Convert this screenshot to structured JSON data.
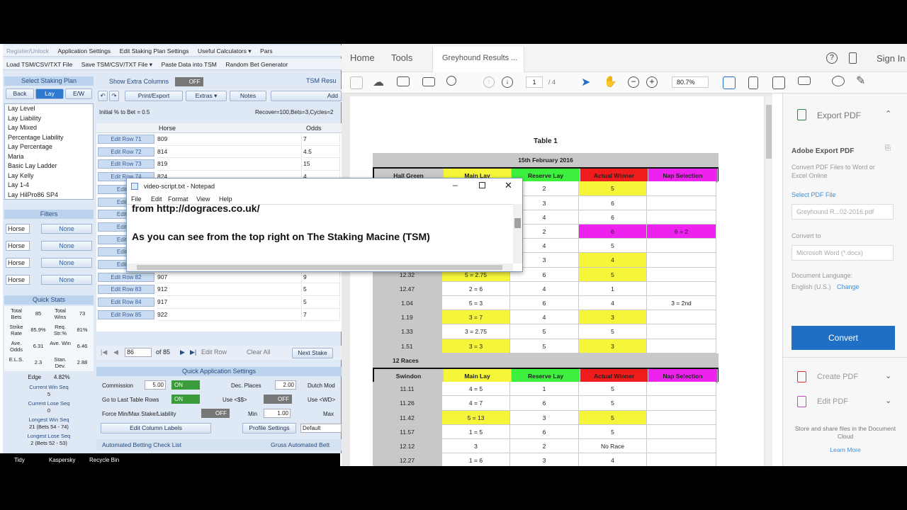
{
  "tsm": {
    "toolbar1": [
      "Register/Unlock",
      "Application Settings",
      "Edit Staking Plan Settings",
      "Useful Calculators ▾",
      "Pars"
    ],
    "toolbar2": [
      "Load TSM/CSV/TXT File",
      "Save TSM/CSV/TXT File ▾",
      "Paste Data into TSM",
      "Random Bet Generator"
    ],
    "select_plan_title": "Select Staking Plan",
    "plan_tabs": [
      "Back",
      "Lay",
      "E/W"
    ],
    "plans": [
      "Lay Level",
      "Lay Liability",
      "Lay Mixed",
      "Percentage Liability",
      "Lay Percentage",
      "Maria",
      "Basic Lay Ladder",
      "Lay Kelly",
      "Lay 1-4",
      "Lay HilPro86 SP4"
    ],
    "filters_title": "Filters",
    "filters": [
      {
        "field": "Horse",
        "value": "None"
      },
      {
        "field": "Horse",
        "value": "None"
      },
      {
        "field": "Horse",
        "value": "None"
      },
      {
        "field": "Horse",
        "value": "None"
      }
    ],
    "quick_stats_title": "Quick Stats",
    "stats": [
      {
        "l1": "Total Bets",
        "v1": "85",
        "l2": "Total Wins",
        "v2": "73"
      },
      {
        "l1": "Strike Rate",
        "v1": "85.9%",
        "l2": "Req. Str.%",
        "v2": "81%"
      },
      {
        "l1": "Ave. Odds",
        "v1": "6.31",
        "l2": "Ave. Win",
        "v2": "6.46"
      },
      {
        "l1": "E.L.S.",
        "v1": "2.3",
        "l2": "Stan. Dev.",
        "v2": "2.88"
      }
    ],
    "edge_label": "Edge",
    "edge_value": "4.82%",
    "seq": [
      {
        "label": "Current Win Seq",
        "value": "5"
      },
      {
        "label": "Current Lose Seq",
        "value": "0"
      },
      {
        "label": "Longest Win Seq",
        "value": "21  (Bets 54 - 74)"
      },
      {
        "label": "Longest Lose Seq",
        "value": "2  (Bets 52 - 53)"
      }
    ],
    "show_extra_columns": "Show Extra Columns",
    "off": "OFF",
    "on": "ON",
    "tsm_results": "TSM Resu",
    "actions": [
      "Print/Export",
      "Extras ▾",
      "Notes",
      "Add"
    ],
    "initial_pct": "Initial % to Bet = 0.5",
    "recover": "Recover=100,Bets=3,Cycles=2",
    "col_horse": "Horse",
    "col_odds": "Odds",
    "rows": [
      {
        "btn": "Edit Row 71",
        "horse": "809",
        "odds": "7"
      },
      {
        "btn": "Edit Row 72",
        "horse": "814",
        "odds": "4.5"
      },
      {
        "btn": "Edit Row 73",
        "horse": "819",
        "odds": "15"
      },
      {
        "btn": "Edit Row 74",
        "horse": "824",
        "odds": "4"
      },
      {
        "btn": "Edit Ro",
        "horse": "",
        "odds": ""
      },
      {
        "btn": "Edit Ro",
        "horse": "",
        "odds": ""
      },
      {
        "btn": "Edit Ro",
        "horse": "",
        "odds": ""
      },
      {
        "btn": "Edit Ro",
        "horse": "",
        "odds": ""
      },
      {
        "btn": "Edit Ro",
        "horse": "",
        "odds": ""
      },
      {
        "btn": "Edit Ro",
        "horse": "",
        "odds": ""
      },
      {
        "btn": "Edit Ro",
        "horse": "",
        "odds": ""
      },
      {
        "btn": "Edit Row 82",
        "horse": "907",
        "odds": "9"
      },
      {
        "btn": "Edit Row 83",
        "horse": "912",
        "odds": "5"
      },
      {
        "btn": "Edit Row 84",
        "horse": "917",
        "odds": "5"
      },
      {
        "btn": "Edit Row 85",
        "horse": "922",
        "odds": "7"
      }
    ],
    "pager_value": "86",
    "pager_of": "of 85",
    "edit_row": "Edit Row",
    "clear_all": "Clear All",
    "next_stake": "Next Stake",
    "quick_settings_title": "Quick Application Settings",
    "commission": "Commission",
    "commission_val": "5.00",
    "dec_places": "Dec. Places",
    "dec_val": "2.00",
    "dutch_mode": "Dutch Mod",
    "goto_last": "Go to Last Table Rows",
    "use_ss": "Use <$$>",
    "use_wd": "Use <WD>",
    "force_minmax": "Force Min/Max Stake/Liability",
    "min": "Min",
    "min_val": "1.00",
    "max": "Max",
    "edit_col_labels": "Edit Column Labels",
    "profile_settings": "Profile Settings",
    "default": "Default",
    "auto_betting": "Automated Betting Check List",
    "gruss": "Gruss Automated Bett"
  },
  "taskbar": [
    "Tidy",
    "Kaspersky",
    "Recycle Bin"
  ],
  "acrobat": {
    "menu": [
      "Home",
      "Tools",
      "Greyhound Results ..."
    ],
    "sign_in": "Sign In",
    "page_current": "1",
    "page_total": "/ 4",
    "zoom": "80.7%",
    "export_pdf": "Export PDF",
    "adobe_export_title": "Adobe Export PDF",
    "adobe_export_desc": "Convert PDF Files to Word or Excel Online",
    "select_pdf_file": "Select PDF File",
    "file_name": "Greyhound R...02-2016.pdf",
    "convert_to": "Convert to",
    "convert_format": "Microsoft Word (*.docx)",
    "doc_language": "Document Language:",
    "language": "English (U.S.)",
    "change": "Change",
    "convert_btn": "Convert",
    "create_pdf": "Create PDF",
    "edit_pdf": "Edit PDF",
    "store_share": "Store and share files in the Document Cloud",
    "learn_more": "Learn More"
  },
  "pdf": {
    "table_title": "Table 1",
    "date": "15th February 2016",
    "header1": [
      "Hall Green",
      "Main Lay",
      "Reserve Lay",
      "Actual Winner",
      "Nap Selection"
    ],
    "rows1": [
      [
        "",
        "",
        "2",
        "5",
        ""
      ],
      [
        "",
        "",
        "3",
        "6",
        ""
      ],
      [
        "",
        "",
        "4",
        "6",
        ""
      ],
      [
        "",
        "",
        "2",
        "6",
        "6 = 2"
      ],
      [
        "",
        "",
        "4",
        "5",
        ""
      ],
      [
        "",
        "",
        "3",
        "4",
        ""
      ],
      [
        "12.32",
        "5 = 2.75",
        "6",
        "5",
        ""
      ],
      [
        "12.47",
        "2 = 6",
        "4",
        "1",
        ""
      ],
      [
        "1.04",
        "5 = 3",
        "6",
        "4",
        "3 = 2nd"
      ],
      [
        "1.19",
        "3 = 7",
        "4",
        "3",
        ""
      ],
      [
        "1.33",
        "3 = 2.75",
        "5",
        "5",
        ""
      ],
      [
        "1.51",
        "3 = 3",
        "5",
        "3",
        ""
      ]
    ],
    "races": "12 Races",
    "header2": [
      "Swindon",
      "Main Lay",
      "Reserve Lay",
      "Actual Winner",
      "Nap Selection"
    ],
    "rows2": [
      [
        "11.11",
        "4 = 5",
        "1",
        "5",
        ""
      ],
      [
        "11.26",
        "4 = 7",
        "6",
        "5",
        ""
      ],
      [
        "11.42",
        "5 = 13",
        "3",
        "5",
        ""
      ],
      [
        "11.57",
        "1 = 5",
        "6",
        "5",
        ""
      ],
      [
        "12.12",
        "3",
        "2",
        "No Race",
        ""
      ],
      [
        "12.27",
        "1 = 6",
        "3",
        "4",
        ""
      ]
    ]
  },
  "notepad": {
    "title": "video-script.txt - Notepad",
    "menu": [
      "File",
      "Edit",
      "Format",
      "View",
      "Help"
    ],
    "line1": "from http://dograces.co.uk/",
    "line2": "As you can see from the top right on The Staking Macine (TSM)"
  },
  "colors": {
    "yellow": "#f5f53a",
    "green": "#3ef03e",
    "red": "#ee1c1c",
    "magenta": "#ee22ee",
    "grey": "#c8c8c8",
    "accent": "#1f6fc5"
  }
}
